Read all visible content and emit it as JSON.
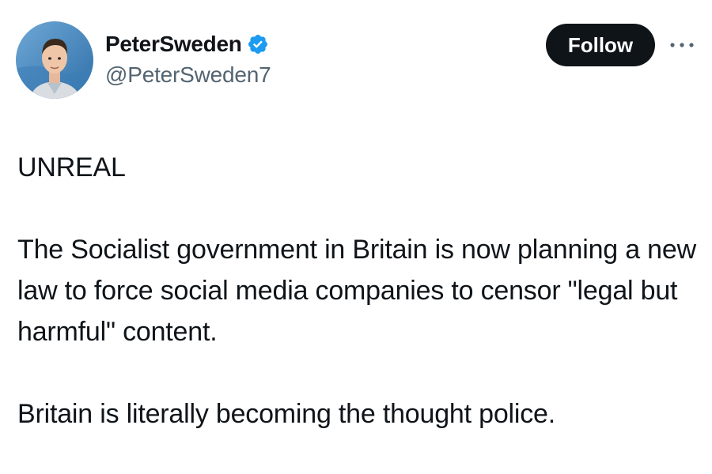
{
  "author": {
    "display_name": "PeterSweden",
    "handle": "@PeterSweden7",
    "verified": true,
    "verified_icon": "verified-badge-icon",
    "avatar_icon": "profile-photo"
  },
  "actions": {
    "follow_label": "Follow",
    "more_icon": "more-options-icon"
  },
  "tweet": {
    "paragraphs": [
      "UNREAL",
      "The Socialist government in Britain is now planning a new law to force social media companies to censor \"legal but harmful\" content.",
      "Britain is literally becoming the thought police."
    ]
  },
  "colors": {
    "text": "#0f1419",
    "secondary_text": "#536471",
    "verified_blue": "#1d9bf0",
    "button_bg": "#0f1419",
    "button_text": "#ffffff"
  }
}
